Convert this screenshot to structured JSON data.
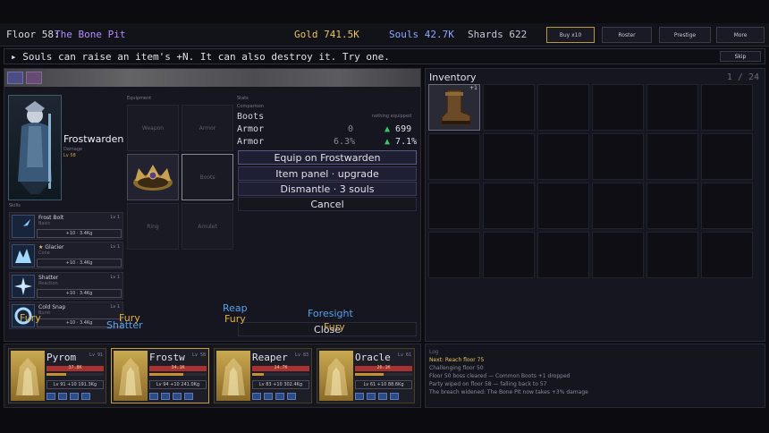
{
  "topbar": {
    "floor_label": "Floor 58:",
    "floor_name": "The Bone Pit",
    "gold": "Gold 741.5K",
    "souls": "Souls 42.7K",
    "shards": "Shards 622",
    "buttons": [
      "Buy x10",
      "Roster",
      "Prestige",
      "More"
    ]
  },
  "banner": {
    "message": "Souls can raise an item's +N. It can also destroy it. Try one.",
    "skip": "Skip"
  },
  "character": {
    "name": "Frostwarden",
    "subclass": "Damage",
    "level": "Lv 58"
  },
  "equipment": {
    "header": "Equipment",
    "slots": [
      "Weapon",
      "Armor",
      "Boots",
      "Ring",
      "Amulet"
    ]
  },
  "stats": {
    "header": "Stats",
    "subheader": "Comparison",
    "item": "Boots",
    "note": "nothing equipped",
    "row1_label": "Armor",
    "row1_cur": "0",
    "row1_new": "699",
    "row2_label": "Armor",
    "row2_cur": "6.3%",
    "row2_new": "7.1%"
  },
  "menu": {
    "equip": "Equip on Frostwarden",
    "upgrade": "Item panel · upgrade",
    "dismantle": "Dismantle · 3 souls",
    "cancel": "Cancel",
    "close": "Close"
  },
  "skills_header": "Skills",
  "skills": [
    {
      "name": "Frost Bolt",
      "type": "Basic",
      "level": "Lv 1",
      "box": "+10 · 3.4Kg"
    },
    {
      "name": "Glacier",
      "type": "Cone",
      "level": "Lv 1",
      "box": "+10 · 3.4Kg"
    },
    {
      "name": "Shatter",
      "type": "Reaction",
      "level": "Lv 1",
      "box": "+10 · 3.4Kg"
    },
    {
      "name": "Cold Snap",
      "type": "Burst",
      "level": "Lv 1",
      "box": "+10 · 3.4Kg"
    }
  ],
  "floating_text": {
    "fury1": "Fury",
    "fury2": "Fury",
    "shatter": "Shatter",
    "reap": "Reap",
    "fury3": "Fury",
    "foresight": "Foresight",
    "fury4": "Fury"
  },
  "inventory": {
    "title": "Inventory",
    "count": "1 / 24",
    "item_badge": "+1"
  },
  "party": [
    {
      "name": "Pyrom",
      "level": "Lv 91",
      "hp": "37.8K",
      "info": "Lv 91  +10  191.3Kg",
      "xp": 0.35
    },
    {
      "name": "Frostw",
      "level": "Lv 58",
      "hp": "34.1K",
      "info": "Lv 94  +10  241.0Kg",
      "xp": 0.6
    },
    {
      "name": "Reaper",
      "level": "Lv 83",
      "hp": "14.7K",
      "info": "Lv 83  +10  302.4Kg",
      "xp": 0.2
    },
    {
      "name": "Oracle",
      "level": "Lv 61",
      "hp": "26.1K",
      "info": "Lv 61  +10  88.6Kg",
      "xp": 0.5
    }
  ],
  "log": {
    "header": "Log",
    "lines": [
      "Next: Reach floor 75",
      "Challenging floor 50",
      "Floor 50 boss cleared — Common Boots +1 dropped",
      "Party wiped on floor 58 — falling back to 57",
      "The breach widened: The Bone Pit now takes +3% damage"
    ]
  },
  "colors": {
    "accent_purple": "#b48cff",
    "gold": "#e8c468",
    "souls": "#8fa8ff",
    "up_green": "#3cc46a",
    "float_gold": "#e0b040",
    "float_blue": "#58a0e8"
  }
}
